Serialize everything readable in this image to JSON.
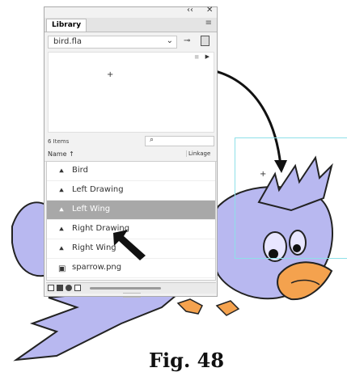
{
  "panel": {
    "collapse_label": "‹‹",
    "close_label": "✕",
    "tab_label": "Library",
    "menu_label": "≡",
    "document": "bird.fla",
    "dropdown_label": "⌄",
    "pin_label": "⊸",
    "items_count": "6 Items",
    "search_icon": "⌕",
    "column_name": "Name",
    "sort_arrow": "↑",
    "column_linkage": "Linkage",
    "items": [
      {
        "label": "Bird",
        "icon": "graphic-icon"
      },
      {
        "label": "Left Drawing",
        "icon": "graphic-icon"
      },
      {
        "label": "Left Wing",
        "icon": "graphic-icon",
        "selected": true
      },
      {
        "label": "Right Drawing",
        "icon": "graphic-icon"
      },
      {
        "label": "Right Wing",
        "icon": "graphic-icon"
      },
      {
        "label": "sparrow.png",
        "icon": "bitmap-icon"
      }
    ]
  },
  "figure_caption": "Fig. 48",
  "colors": {
    "bird_fill": "#b8b8f0",
    "beak": "#f4a24e",
    "selected_row": "#a8a8a8",
    "stage_outline": "#8ee0e8"
  }
}
